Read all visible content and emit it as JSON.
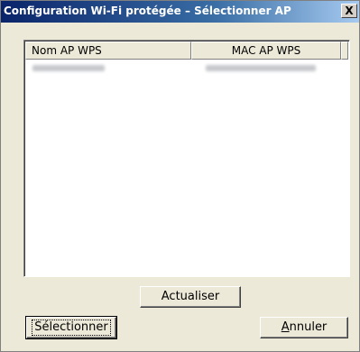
{
  "window": {
    "title": "Configuration Wi-Fi protégée – Sélectionner AP",
    "close_label": "X"
  },
  "list": {
    "columns": [
      "Nom AP WPS",
      "MAC AP WPS"
    ],
    "rows": [
      {
        "name": "",
        "mac": ""
      }
    ]
  },
  "buttons": {
    "refresh": "Actualiser",
    "select": "Sélectionner",
    "cancel_access_key": "A",
    "cancel_rest": "nnuler"
  }
}
